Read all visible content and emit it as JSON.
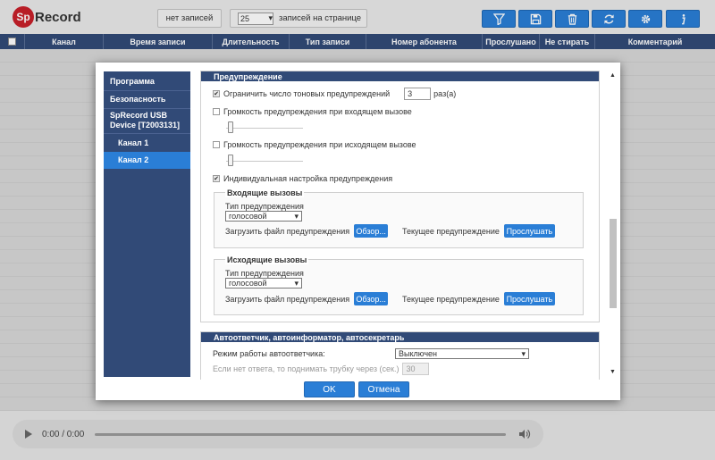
{
  "app": {
    "logo_badge": "Sp",
    "logo_text": "Record"
  },
  "toolbar": {
    "no_records": "нет записей",
    "per_page_value": "25",
    "per_page_label": "записей на странице",
    "buttons": [
      {
        "icon": "filter-icon"
      },
      {
        "icon": "save-icon"
      },
      {
        "icon": "trash-icon"
      },
      {
        "icon": "refresh-icon"
      },
      {
        "icon": "gear-icon"
      },
      {
        "icon": "info-icon"
      }
    ]
  },
  "table": {
    "columns": [
      "Канал",
      "Время записи",
      "Длительность",
      "Тип записи",
      "Номер абонента",
      "Прослушано",
      "Не стирать",
      "Комментарий"
    ]
  },
  "player": {
    "time": "0:00 / 0:00"
  },
  "modal": {
    "sidebar": {
      "items": [
        "Программа",
        "Безопасность",
        "SpRecord USB Device [T2003131]",
        "Канал 1",
        "Канал 2"
      ],
      "active_index": 4
    },
    "warning": {
      "title": "Предупреждение",
      "limit_label": "Ограничить число тоновых предупреждений",
      "limit_checked": true,
      "limit_value": "3",
      "limit_unit": "раз(а)",
      "incoming_volume_label": "Громкость предупреждения при входящем вызове",
      "incoming_volume_checked": false,
      "incoming_volume_level": 0,
      "outgoing_volume_label": "Громкость предупреждения при исходящем вызове",
      "outgoing_volume_checked": false,
      "outgoing_volume_level": 0,
      "individual_label": "Индивидуальная настройка предупреждения",
      "individual_checked": true,
      "incoming": {
        "legend": "Входящие вызовы",
        "type_label": "Тип предупреждения",
        "type_value": "голосовой",
        "upload_label": "Загрузить файл предупреждения",
        "browse_label": "Обзор...",
        "current_label": "Текущее предупреждение",
        "listen_label": "Прослушать"
      },
      "outgoing": {
        "legend": "Исходящие вызовы",
        "type_label": "Тип предупреждения",
        "type_value": "голосовой",
        "upload_label": "Загрузить файл предупреждения",
        "browse_label": "Обзор...",
        "current_label": "Текущее предупреждение",
        "listen_label": "Прослушать"
      }
    },
    "autoanswer": {
      "title": "Автоответчик, автоинформатор, автосекретарь",
      "mode_label": "Режим работы автоответчика:",
      "mode_value": "Выключен",
      "rings_label": "Если нет ответа, то поднимать трубку через (сек.)",
      "rings_value": "30"
    },
    "ok_label": "OK",
    "cancel_label": "Отмена"
  }
}
